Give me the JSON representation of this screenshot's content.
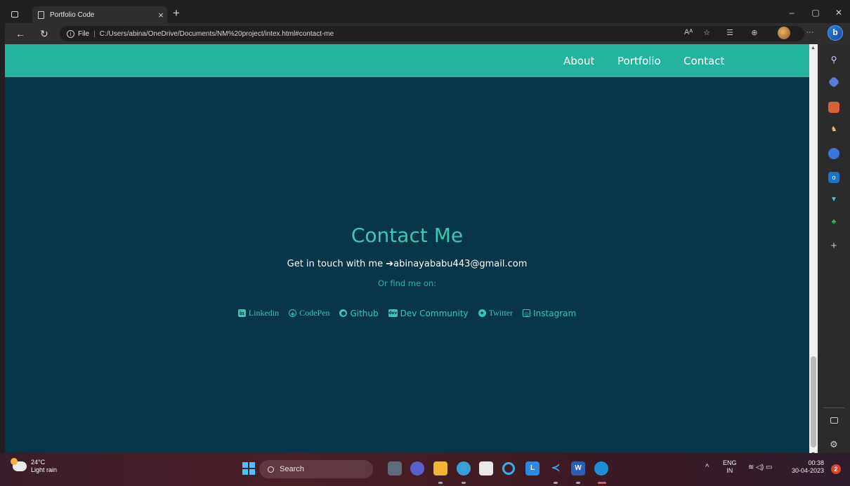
{
  "browser": {
    "tab_title": "Portfolio Code",
    "tab_close": "×",
    "new_tab": "+",
    "window_controls": {
      "minimize": "–",
      "maximize": "▢",
      "close": "✕"
    },
    "nav": {
      "back": "←",
      "reload": "↻"
    },
    "address": {
      "info": "i",
      "scheme_label": "File",
      "separator": "|",
      "url": "C:/Users/abina/OneDrive/Documents/NM%20project/intex.html#contact-me"
    },
    "toolbar": {
      "read_aloud": "Aᴬ",
      "favorite": "☆",
      "favorites_list": "☰",
      "collections": "⊕",
      "more": "···",
      "bing": "b"
    }
  },
  "page": {
    "nav_links": [
      "About",
      "Portfolio",
      "Contact"
    ],
    "contact_title": "Contact Me",
    "touch_prefix": "Get in touch with me",
    "touch_arrow": "➔",
    "email": "abinayababu443@gmail.com",
    "find_me": "Or find me on:",
    "socials": [
      {
        "label": "Linkedin",
        "icon": "linkedin-icon",
        "glyph": "in"
      },
      {
        "label": "CodePen",
        "icon": "codepen-icon",
        "glyph": "◈"
      },
      {
        "label": "Github",
        "icon": "github-icon",
        "glyph": "●"
      },
      {
        "label": "Dev Community",
        "icon": "dev-icon",
        "glyph": "dev"
      },
      {
        "label": "Twitter",
        "icon": "twitter-icon",
        "glyph": "✦"
      },
      {
        "label": "Instagram",
        "icon": "instagram-icon",
        "glyph": "◎"
      }
    ],
    "colors": {
      "nav_bg": "#24b49d",
      "page_bg": "#063648",
      "accent": "#3bc8ad"
    }
  },
  "sidebar": {
    "icons": [
      "search-icon",
      "tag-icon",
      "briefcase-icon",
      "chess-icon",
      "circle-icon",
      "outlook-icon",
      "send-icon",
      "tree-icon",
      "add-icon"
    ],
    "add": "+",
    "bottom_icons": [
      "split-screen-icon",
      "settings-icon"
    ]
  },
  "taskbar": {
    "temperature": "24°C",
    "condition": "Light rain",
    "search_label": "Search",
    "language_top": "ENG",
    "language_bottom": "IN",
    "time": "00:38",
    "date": "30-04-2023",
    "notifications": "2",
    "chevron": "^",
    "status_icons": "≋ ◁) ▭"
  }
}
